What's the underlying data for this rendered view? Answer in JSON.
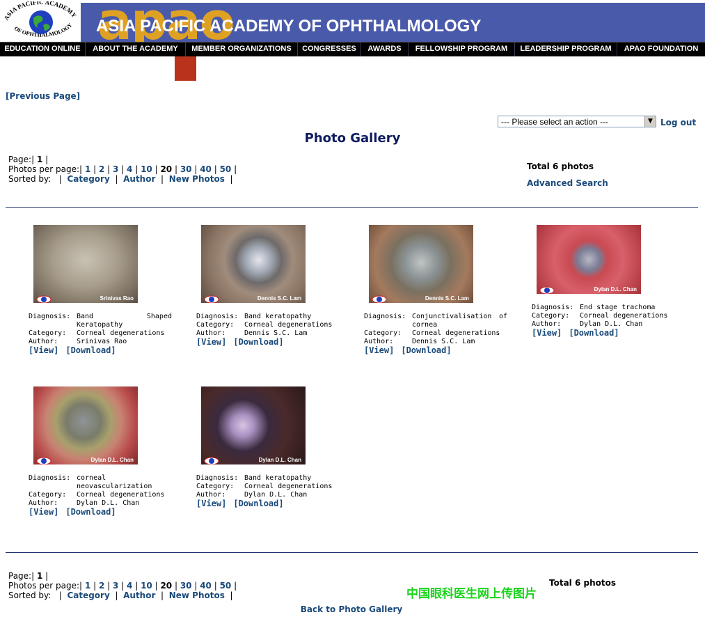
{
  "brand": {
    "logo_text": "ASIA PACIFIC ACADEMY OF OPHTHALMOLOGY",
    "banner_word": "apao",
    "banner_title": "ASIA PACIFIC ACADEMY OF OPHTHALMOLOGY"
  },
  "nav": [
    "EDUCATION ONLINE",
    "ABOUT THE ACADEMY",
    "MEMBER ORGANIZATIONS",
    "CONGRESSES",
    "AWARDS",
    "FELLOWSHIP PROGRAM",
    "LEADERSHIP PROGRAM",
    "APAO FOUNDATION"
  ],
  "previous_page": "[Previous Page]",
  "action_select": {
    "value": "--- Please select an action ---"
  },
  "logout": "Log out",
  "page_title": "Photo Gallery",
  "pager": {
    "page_label": "Page:|",
    "current_page": "1",
    "page_sep": "|",
    "per_page_label": "Photos per page:|",
    "per_page": [
      "1",
      "2",
      "3",
      "4",
      "10",
      "20",
      "30",
      "40",
      "50"
    ],
    "per_page_current": "20",
    "sort_label": "Sorted by:",
    "sort_options": [
      "Category",
      "Author",
      "New Photos"
    ]
  },
  "total": "Total 6 photos",
  "advanced_search": "Advanced Search",
  "labels": {
    "diagnosis": "Diagnosis:",
    "category": "Category:",
    "author": "Author:",
    "view": "[View]",
    "download": "[Download]"
  },
  "photos": [
    {
      "diagnosis": "Band Shaped Keratopathy",
      "category": "Corneal degenerations",
      "author": "Srinivas Rao",
      "credit": "Srinivas Rao"
    },
    {
      "diagnosis": "Band keratopathy",
      "category": "Corneal degenerations",
      "author": "Dennis S.C. Lam",
      "credit": "Dennis S.C. Lam"
    },
    {
      "diagnosis": "Conjunctivalisation of cornea",
      "category": "Corneal degenerations",
      "author": "Dennis S.C. Lam",
      "credit": "Dennis S.C. Lam"
    },
    {
      "diagnosis": "End stage trachoma",
      "category": "Corneal degenerations",
      "author": "Dylan D.L. Chan",
      "credit": "Dylan D.L. Chan"
    },
    {
      "diagnosis": "corneal neovascularization",
      "category": "Corneal degenerations",
      "author": "Dylan D.L. Chan",
      "credit": "Dylan D.L. Chan"
    },
    {
      "diagnosis": "Band keratopathy",
      "category": "Corneal degenerations",
      "author": "Dylan D.L. Chan",
      "credit": "Dylan D.L. Chan"
    }
  ],
  "watermark": "中国眼科医生网上传图片",
  "back_link": "Back to Photo Gallery",
  "colors": {
    "banner_blue": "#4a5aaa",
    "banner_word": "#e8a51c",
    "link": "#1a4a7a",
    "title": "#0d1a5e",
    "watermark": "#19d41a"
  }
}
